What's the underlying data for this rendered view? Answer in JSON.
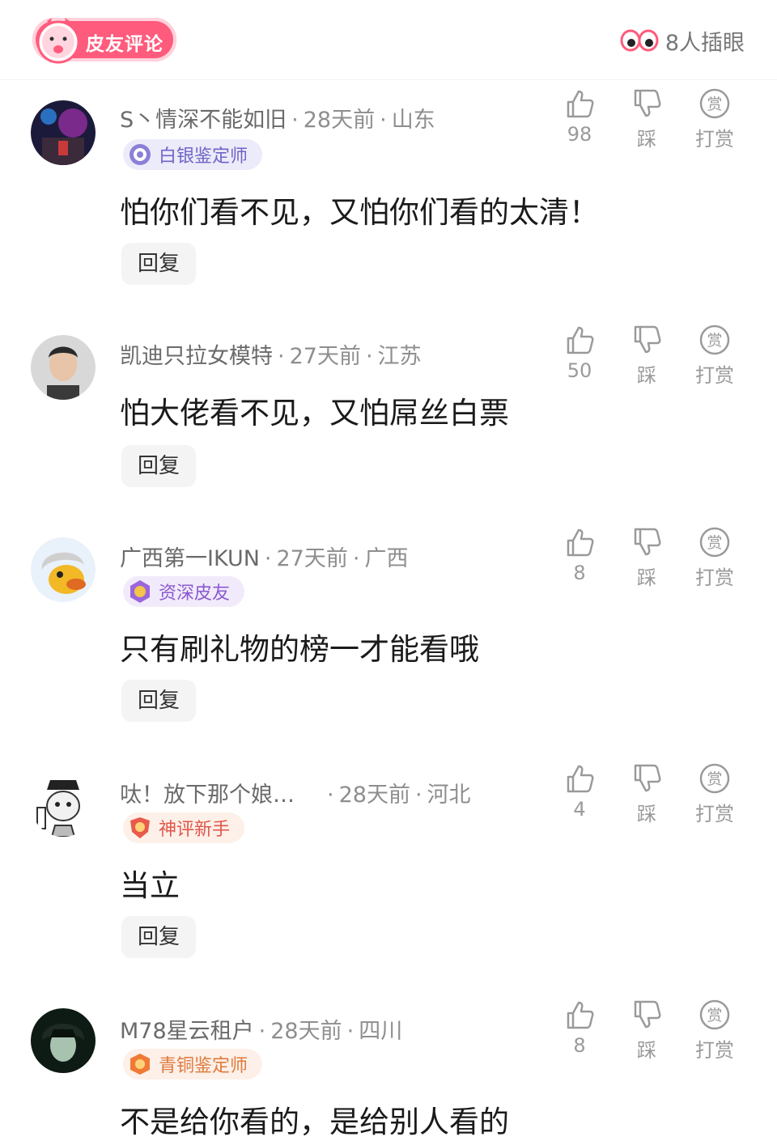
{
  "header": {
    "title": "皮友评论",
    "peek_text": "8人插眼"
  },
  "actions": {
    "dislike_label": "踩",
    "reward_label": "打赏",
    "reward_glyph": "赏",
    "reply_label": "回复"
  },
  "comments": [
    {
      "name": "S丶情深不能如旧",
      "time": "28天前",
      "location": "山东",
      "badge": "白银鉴定师",
      "badge_color": "#6e64c8",
      "badge_bg": "#ecebf9",
      "text": "怕你们看不见，又怕你们看的太清！",
      "likes": "98"
    },
    {
      "name": "凯迪只拉女模特",
      "time": "27天前",
      "location": "江苏",
      "badge": "",
      "text": "怕大佬看不见，又怕屌丝白票",
      "likes": "50"
    },
    {
      "name": "广西第一IKUN",
      "time": "27天前",
      "location": "广西",
      "badge": "资深皮友",
      "badge_color": "#8a5ad0",
      "badge_bg": "#f1eafb",
      "text": "只有刷礼物的榜一才能看哦",
      "likes": "8"
    },
    {
      "name": "呔！放下那个娘…",
      "time": "28天前",
      "location": "河北",
      "badge": "神评新手",
      "badge_color": "#e0564c",
      "badge_bg": "#fdf0e8",
      "text": "当立",
      "likes": "4"
    },
    {
      "name": "M78星云租户",
      "time": "28天前",
      "location": "四川",
      "badge": "青铜鉴定师",
      "badge_color": "#e07a3c",
      "badge_bg": "#fdf0e8",
      "text": "不是给你看的，是给别人看的",
      "likes": "8"
    }
  ]
}
